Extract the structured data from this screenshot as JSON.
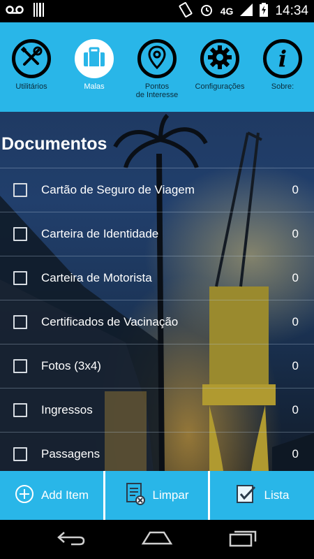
{
  "status_bar": {
    "network": "4G",
    "time": "14:34"
  },
  "nav": {
    "items": [
      {
        "label": "Utilitários",
        "icon": "tools-icon",
        "active": false
      },
      {
        "label": "Malas",
        "icon": "suitcase-icon",
        "active": true
      },
      {
        "label_line1": "Pontos",
        "label_line2": "de Interesse",
        "icon": "map-pin-icon",
        "active": false
      },
      {
        "label": "Configurações",
        "icon": "gear-icon",
        "active": false
      },
      {
        "label": "Sobre:",
        "icon": "info-icon",
        "active": false
      }
    ]
  },
  "section": {
    "title": "Documentos"
  },
  "items": [
    {
      "label": "Cartão de Seguro de Viagem",
      "count": "0"
    },
    {
      "label": "Carteira de Identidade",
      "count": "0"
    },
    {
      "label": "Carteira de Motorista",
      "count": "0"
    },
    {
      "label": "Certificados de Vacinação",
      "count": "0"
    },
    {
      "label": "Fotos (3x4)",
      "count": "0"
    },
    {
      "label": "Ingressos",
      "count": "0"
    },
    {
      "label": "Passagens",
      "count": "0"
    }
  ],
  "actions": {
    "add_label": "Add Item",
    "clear_label": "Limpar",
    "list_label": "Lista"
  },
  "colors": {
    "accent": "#29b6e8"
  }
}
